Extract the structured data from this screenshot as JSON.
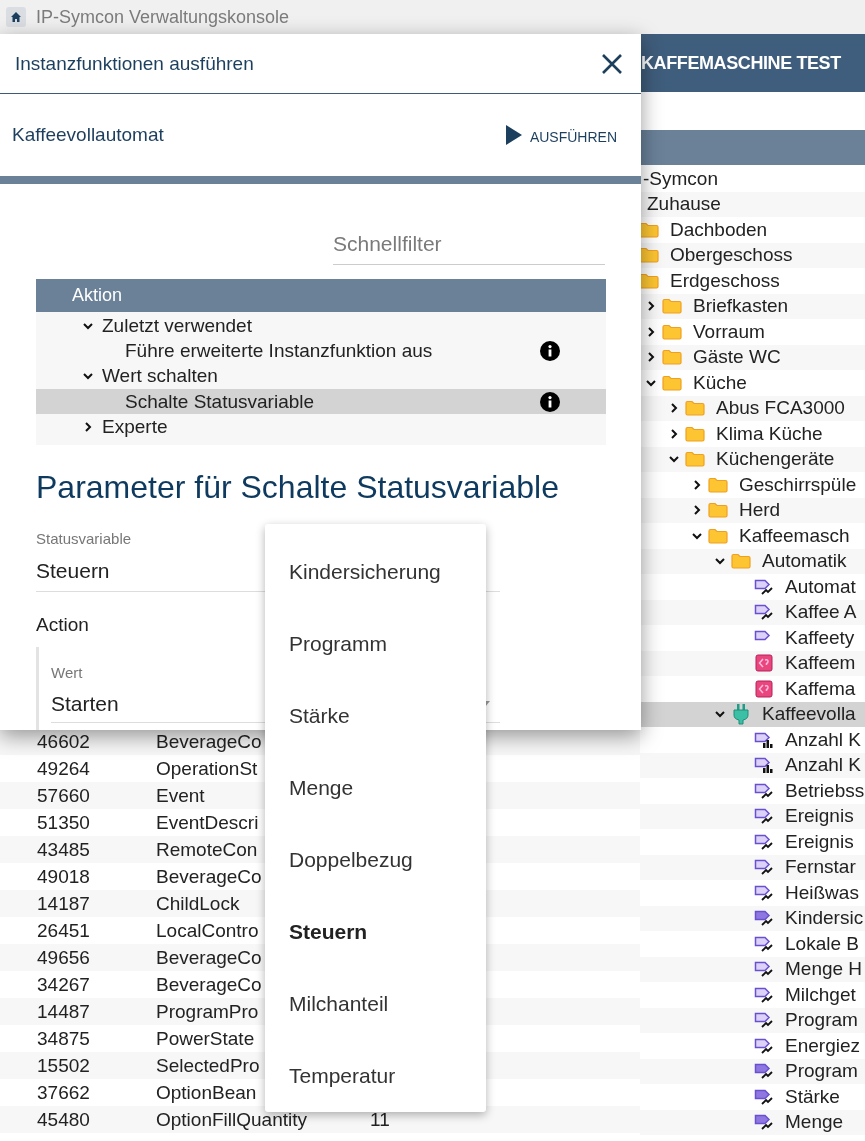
{
  "window": {
    "title": "IP-Symcon Verwaltungskonsole"
  },
  "dialog": {
    "title": "Instanzfunktionen ausführen",
    "instance": "Kaffeevollautomat",
    "run_button": "AUSFÜHREN",
    "filter": {
      "placeholder": "Schnellfilter"
    },
    "actions": {
      "header": "Aktion",
      "items": [
        {
          "label": "Zuletzt verwendet",
          "expanded": true,
          "selected": false,
          "children": [
            {
              "label": "Führe erweiterte Instanzfunktion aus",
              "selected": false
            }
          ]
        },
        {
          "label": "Wert schalten",
          "expanded": true,
          "selected": false,
          "children": [
            {
              "label": "Schalte Statusvariable",
              "selected": true
            }
          ]
        },
        {
          "label": "Experte",
          "expanded": false,
          "selected": false
        }
      ]
    },
    "parameters_title": "Parameter für Schalte Statusvariable",
    "status_field": {
      "label": "Statusvariable",
      "value": "Steuern"
    },
    "action_label": "Action",
    "value_field": {
      "label": "Wert",
      "value": "Starten"
    }
  },
  "dropdown": {
    "options": [
      {
        "label": "Kindersicherung",
        "selected": false
      },
      {
        "label": "Programm",
        "selected": false
      },
      {
        "label": "Stärke",
        "selected": false
      },
      {
        "label": "Menge",
        "selected": false
      },
      {
        "label": "Doppelbezug",
        "selected": false
      },
      {
        "label": "Steuern",
        "selected": true
      },
      {
        "label": "Milchanteil",
        "selected": false
      },
      {
        "label": "Temperatur",
        "selected": false
      }
    ]
  },
  "object_tree": {
    "title": "KAFFEMASCHINE TEST",
    "items": [
      {
        "label": "-Symcon",
        "selected": false,
        "children": [
          {
            "label": "Zuhause",
            "selected": false,
            "children": [
              {
                "label": "Dachboden",
                "kind": "folder",
                "selected": false
              },
              {
                "label": "Obergeschoss",
                "kind": "folder",
                "selected": false
              },
              {
                "label": "Erdgeschoss",
                "kind": "folder",
                "selected": false,
                "children": [
                  {
                    "label": "Briefkasten",
                    "kind": "folder",
                    "expanded": false,
                    "selected": false
                  },
                  {
                    "label": "Vorraum",
                    "kind": "folder",
                    "expanded": false,
                    "selected": false
                  },
                  {
                    "label": "Gäste WC",
                    "kind": "folder",
                    "expanded": false,
                    "selected": false
                  },
                  {
                    "label": "Küche",
                    "kind": "folder",
                    "expanded": true,
                    "selected": false,
                    "children": [
                      {
                        "label": "Abus FCA3000",
                        "kind": "folder",
                        "expanded": false,
                        "selected": false
                      },
                      {
                        "label": "Klima Küche",
                        "kind": "folder",
                        "expanded": false,
                        "selected": false
                      },
                      {
                        "label": "Küchengeräte",
                        "kind": "folder",
                        "expanded": true,
                        "selected": false,
                        "children": [
                          {
                            "label": "Geschirrspüle",
                            "kind": "folder",
                            "expanded": false,
                            "selected": false
                          },
                          {
                            "label": "Herd",
                            "kind": "folder",
                            "expanded": false,
                            "selected": false
                          },
                          {
                            "label": "Kaffeemasch",
                            "kind": "folder",
                            "expanded": true,
                            "selected": false,
                            "children": [
                              {
                                "label": "Automatik",
                                "kind": "folder",
                                "expanded": true,
                                "selected": false,
                                "children": [
                                  {
                                    "label": "Automat",
                                    "kind": "variable",
                                    "selected": false
                                  },
                                  {
                                    "label": "Kaffee A",
                                    "kind": "variable",
                                    "selected": false
                                  },
                                  {
                                    "label": "Kaffeety",
                                    "kind": "variable-plain",
                                    "selected": false
                                  },
                                  {
                                    "label": "Kaffeem",
                                    "kind": "script",
                                    "selected": false
                                  },
                                  {
                                    "label": "Kaffema",
                                    "kind": "script",
                                    "selected": false
                                  }
                                ]
                              },
                              {
                                "label": "Kaffeevolla",
                                "kind": "instance",
                                "expanded": true,
                                "selected": true,
                                "children": [
                                  {
                                    "label": "Anzahl K",
                                    "kind": "variable-chart",
                                    "selected": false
                                  },
                                  {
                                    "label": "Anzahl K",
                                    "kind": "variable-chart",
                                    "selected": false
                                  },
                                  {
                                    "label": "Betriebss",
                                    "kind": "variable",
                                    "selected": false
                                  },
                                  {
                                    "label": "Ereignis",
                                    "kind": "variable",
                                    "selected": false
                                  },
                                  {
                                    "label": "Ereignis",
                                    "kind": "variable",
                                    "selected": false
                                  },
                                  {
                                    "label": "Fernstar",
                                    "kind": "variable",
                                    "selected": false
                                  },
                                  {
                                    "label": "Heißwas",
                                    "kind": "variable",
                                    "selected": false
                                  },
                                  {
                                    "label": "Kindersic",
                                    "kind": "variable-action",
                                    "selected": false
                                  },
                                  {
                                    "label": "Lokale B",
                                    "kind": "variable",
                                    "selected": false
                                  },
                                  {
                                    "label": "Menge H",
                                    "kind": "variable",
                                    "selected": false
                                  },
                                  {
                                    "label": "Milchget",
                                    "kind": "variable",
                                    "selected": false
                                  },
                                  {
                                    "label": "Program",
                                    "kind": "variable",
                                    "selected": false
                                  },
                                  {
                                    "label": "Energiez",
                                    "kind": "variable",
                                    "selected": false
                                  },
                                  {
                                    "label": "Program",
                                    "kind": "variable-action",
                                    "selected": false
                                  },
                                  {
                                    "label": "Stärke",
                                    "kind": "variable-action",
                                    "selected": false
                                  },
                                  {
                                    "label": "Menge",
                                    "kind": "variable-action",
                                    "selected": false
                                  }
                                ]
                              }
                            ]
                          }
                        ]
                      }
                    ]
                  }
                ]
              }
            ]
          }
        ]
      }
    ]
  },
  "variables_table": {
    "rows": [
      {
        "id": "46602",
        "name": "BeverageCo"
      },
      {
        "id": "49264",
        "name": "OperationSt"
      },
      {
        "id": "57660",
        "name": "Event"
      },
      {
        "id": "51350",
        "name": "EventDescri"
      },
      {
        "id": "43485",
        "name": "RemoteCon"
      },
      {
        "id": "49018",
        "name": "BeverageCo"
      },
      {
        "id": "14187",
        "name": "ChildLock"
      },
      {
        "id": "26451",
        "name": "LocalContro"
      },
      {
        "id": "49656",
        "name": "BeverageCo"
      },
      {
        "id": "34267",
        "name": "BeverageCo"
      },
      {
        "id": "14487",
        "name": "ProgramPro"
      },
      {
        "id": "34875",
        "name": "PowerState"
      },
      {
        "id": "15502",
        "name": "SelectedPro"
      },
      {
        "id": "37662",
        "name": "OptionBean"
      },
      {
        "id": "45480",
        "name": "OptionFillQuantity",
        "column_3": "11"
      }
    ]
  }
}
